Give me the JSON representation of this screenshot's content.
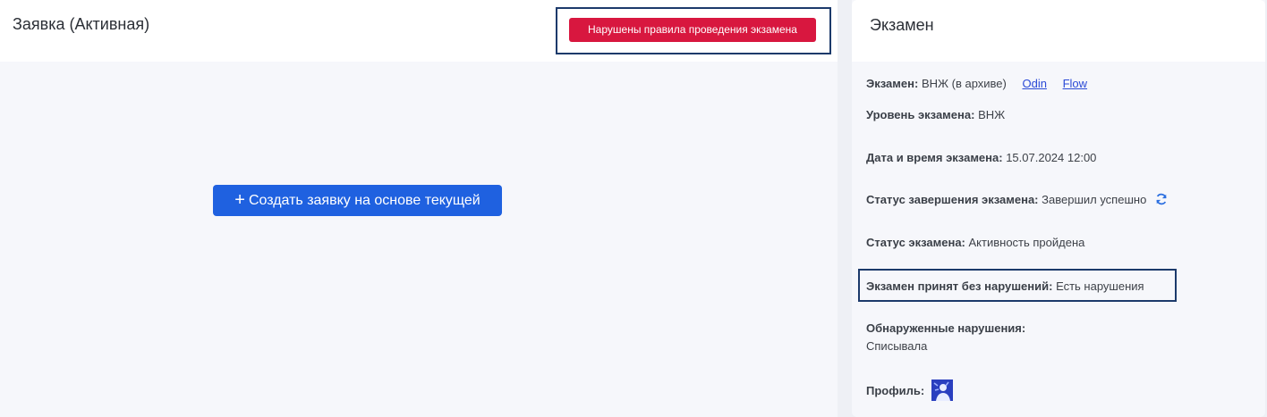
{
  "request": {
    "title": "Заявка (Активная)",
    "violation_button": "Нарушены правила проведения экзамена",
    "create_button": "Создать заявку на основе текущей"
  },
  "exam": {
    "title": "Экзамен",
    "exam_label": "Экзамен:",
    "exam_value": "ВНЖ (в архиве)",
    "link_odin": "Odin",
    "link_flow": "Flow",
    "level_label": "Уровень экзамена:",
    "level_value": "ВНЖ",
    "datetime_label": "Дата и время экзамена:",
    "datetime_value": "15.07.2024 12:00",
    "completion_label": "Статус завершения экзамена:",
    "completion_value": "Завершил успешно",
    "status_label": "Статус экзамена:",
    "status_value": "Активность пройдена",
    "accepted_label": "Экзамен принят без нарушений:",
    "accepted_value": "Есть нарушения",
    "violations_label": "Обнаруженные нарушения:",
    "violations_value": "Списывала",
    "profile_label": "Профиль:"
  },
  "colors": {
    "violation": "#d8173f",
    "primary": "#1f61e0",
    "highlight_border": "#1c3a6b",
    "link": "#2b4ad6"
  }
}
